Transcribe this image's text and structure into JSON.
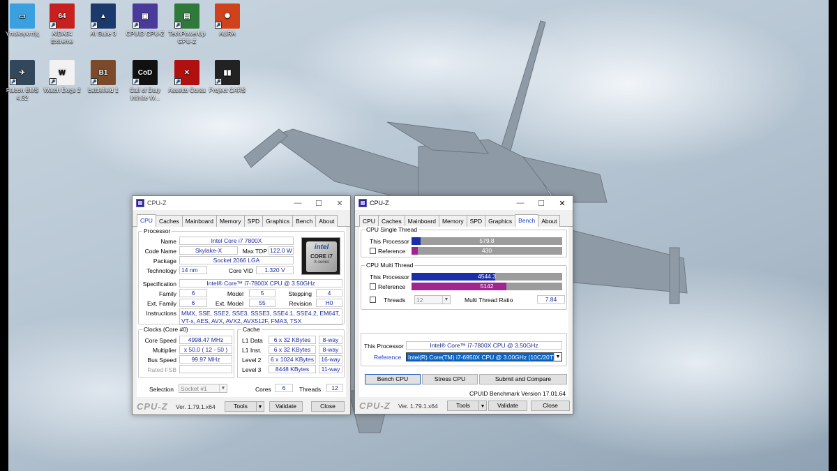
{
  "desktop": {
    "icons": [
      {
        "label": "Υπολογιστής",
        "icon": "computer-icon",
        "color": "#3aa0e0",
        "glyph": "▭"
      },
      {
        "label": "AIDA64 Extreme",
        "icon": "aida64-icon",
        "color": "#c8201e",
        "glyph": "64"
      },
      {
        "label": "AI Suite 3",
        "icon": "ai-suite-icon",
        "color": "#1b3a6b",
        "glyph": "▲"
      },
      {
        "label": "CPUID CPU-Z",
        "icon": "cpuz-icon",
        "color": "#4a3a9a",
        "glyph": "▣"
      },
      {
        "label": "TechPowerUp GPU-Z",
        "icon": "gpuz-icon",
        "color": "#2f7a3a",
        "glyph": "▤"
      },
      {
        "label": "AURA",
        "icon": "aura-icon",
        "color": "#d0421b",
        "glyph": "✺"
      },
      {
        "label": "Falcon BMS 4.32",
        "icon": "falcon-bms-icon",
        "color": "#33475b",
        "glyph": "✈"
      },
      {
        "label": "Watch Dogs 2",
        "icon": "watch-dogs-icon",
        "color": "#f2f2f2",
        "glyph": "W"
      },
      {
        "label": "battlefield 1",
        "icon": "battlefield-icon",
        "color": "#7a4a2a",
        "glyph": "B1"
      },
      {
        "label": "Call of Duty Infinite W...",
        "icon": "call-of-duty-icon",
        "color": "#111111",
        "glyph": "CoD"
      },
      {
        "label": "Assetto Corsa",
        "icon": "assetto-corsa-icon",
        "color": "#b01010",
        "glyph": "✕"
      },
      {
        "label": "Project CARS",
        "icon": "project-cars-icon",
        "color": "#222222",
        "glyph": "▮▮"
      }
    ]
  },
  "win1": {
    "title": "CPU-Z",
    "tabs": [
      "CPU",
      "Caches",
      "Mainboard",
      "Memory",
      "SPD",
      "Graphics",
      "Bench",
      "About"
    ],
    "processor": {
      "group": "Processor",
      "name_lbl": "Name",
      "name": "Intel Core i7 7800X",
      "codename_lbl": "Code Name",
      "codename": "Skylake-X",
      "tdp_lbl": "Max TDP",
      "tdp": "122.0 W",
      "package_lbl": "Package",
      "package": "Socket 2066 LGA",
      "tech_lbl": "Technology",
      "tech": "14 nm",
      "vid_lbl": "Core VID",
      "vid": "1.320 V",
      "spec_lbl": "Specification",
      "spec": "Intel® Core™ i7-7800X CPU @ 3.50GHz",
      "family_lbl": "Family",
      "family": "6",
      "model_lbl": "Model",
      "model": "5",
      "stepping_lbl": "Stepping",
      "stepping": "4",
      "extfamily_lbl": "Ext. Family",
      "extfamily": "6",
      "extmodel_lbl": "Ext. Model",
      "extmodel": "55",
      "revision_lbl": "Revision",
      "revision": "H0",
      "instr_lbl": "Instructions",
      "instr": "MMX, SSE, SSE2, SSE3, SSSE3, SSE4.1, SSE4.2, EM64T, VT-x, AES, AVX, AVX2, AVX512F, FMA3, TSX",
      "badge_intel": "intel",
      "badge_core": "CORE i7",
      "badge_series": "X-series"
    },
    "clocks": {
      "group": "Clocks (Core #0)",
      "speed_lbl": "Core Speed",
      "speed": "4998.47 MHz",
      "mult_lbl": "Multiplier",
      "mult": "x 50.0 ( 12 - 50 )",
      "bus_lbl": "Bus Speed",
      "bus": "99.97 MHz",
      "fsb_lbl": "Rated FSB",
      "fsb": ""
    },
    "cache": {
      "group": "Cache",
      "l1d_lbl": "L1 Data",
      "l1d": "6 x 32 KBytes",
      "l1d_w": "8-way",
      "l1i_lbl": "L1 Inst.",
      "l1i": "6 x 32 KBytes",
      "l1i_w": "8-way",
      "l2_lbl": "Level 2",
      "l2": "6 x 1024 KBytes",
      "l2_w": "16-way",
      "l3_lbl": "Level 3",
      "l3": "8448 KBytes",
      "l3_w": "11-way"
    },
    "selection_lbl": "Selection",
    "selection": "Socket #1",
    "cores_lbl": "Cores",
    "cores": "6",
    "threads_lbl": "Threads",
    "threads": "12",
    "logo": "CPU-Z",
    "version": "Ver. 1.79.1.x64",
    "tools": "Tools",
    "validate": "Validate",
    "close": "Close"
  },
  "win2": {
    "title": "CPU-Z",
    "tabs": [
      "CPU",
      "Caches",
      "Mainboard",
      "Memory",
      "SPD",
      "Graphics",
      "Bench",
      "About"
    ],
    "single": {
      "group": "CPU Single Thread",
      "this_lbl": "This Processor",
      "this_val": "579.8",
      "this_frac": 0.058,
      "ref_lbl": "Reference",
      "ref_val": "430",
      "ref_frac": 0.043
    },
    "multi": {
      "group": "CPU Multi Thread",
      "this_lbl": "This Processor",
      "this_val": "4544.3",
      "this_frac": 0.556,
      "ref_lbl": "Reference",
      "ref_val": "5142",
      "ref_frac": 0.63,
      "threads_lbl": "Threads",
      "threads": "12",
      "ratio_lbl": "Multi Thread Ratio",
      "ratio": "7.84"
    },
    "this_proc_lbl": "This Processor",
    "this_proc": "Intel® Core™ i7-7800X CPU @ 3.50GHz",
    "reference_lbl": "Reference",
    "reference": "Intel(R) Core(TM) i7-6950X CPU @ 3.00GHz (10C/20T)",
    "bench_btn": "Bench CPU",
    "stress_btn": "Stress CPU",
    "submit_btn": "Submit and Compare",
    "bench_version": "CPUID Benchmark Version 17.01.64",
    "logo": "CPU-Z",
    "version": "Ver. 1.79.1.x64",
    "tools": "Tools",
    "validate": "Validate",
    "close": "Close",
    "colors": {
      "this": "#1c2da8",
      "ref": "#a0258f"
    }
  }
}
